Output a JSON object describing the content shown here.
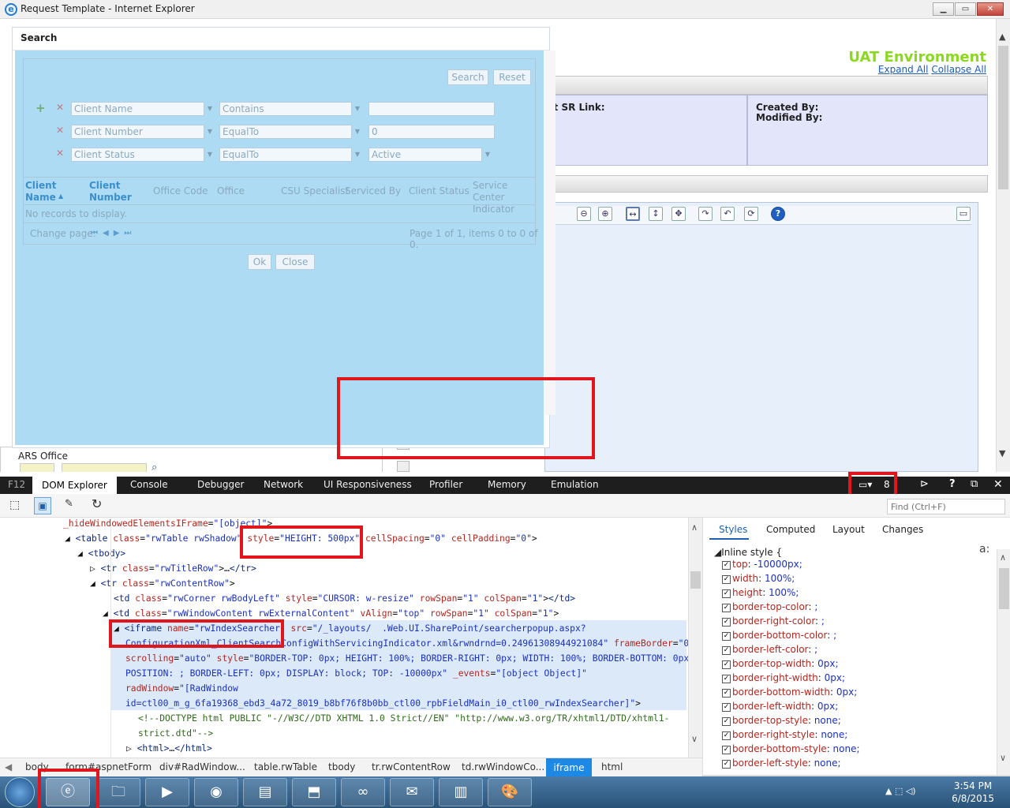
{
  "window": {
    "title": "Request Template - Internet Explorer"
  },
  "page": {
    "environment": "UAT Environment",
    "expand_all": "Expand All",
    "collapse_all": "Collapse All",
    "sr_link": "nt SR Link:",
    "created_by": "Created By:",
    "modified_by": "Modified By:",
    "ars_office": "ARS Office"
  },
  "search": {
    "header": "Search",
    "search_btn": "Search",
    "reset_btn": "Reset",
    "rows": [
      {
        "field": "Client Name",
        "op": "Contains",
        "value": ""
      },
      {
        "field": "Client Number",
        "op": "EqualTo",
        "value": "0"
      },
      {
        "field": "Client Status",
        "op": "EqualTo",
        "value": "Active"
      }
    ],
    "columns": [
      "Client Name",
      "Client Number",
      "Office Code",
      "Office",
      "CSU Specialist",
      "Serviced By",
      "Client Status",
      "Service Center Indicator"
    ],
    "no_records": "No records to display.",
    "change_page": "Change page:",
    "page_info": "Page 1 of 1, items 0 to 0 of 0.",
    "ok_btn": "Ok",
    "close_btn": "Close"
  },
  "devtools": {
    "tabs": [
      "F12",
      "DOM Explorer",
      "Console",
      "Debugger",
      "Network",
      "UI Responsiveness",
      "Profiler",
      "Memory",
      "Emulation"
    ],
    "emulation_mode": "8",
    "find_placeholder": "Find (Ctrl+F)",
    "style_tabs": [
      "Styles",
      "Computed",
      "Layout",
      "Changes"
    ],
    "inline_style": "Inline style  {",
    "styles": [
      {
        "name": "top",
        "value": "-10000px;"
      },
      {
        "name": "width",
        "value": "100%;"
      },
      {
        "name": "height",
        "value": "100%;"
      },
      {
        "name": "border-top-color",
        "value": ";"
      },
      {
        "name": "border-right-color",
        "value": ";"
      },
      {
        "name": "border-bottom-color",
        "value": ";"
      },
      {
        "name": "border-left-color",
        "value": ";"
      },
      {
        "name": "border-top-width",
        "value": "0px;"
      },
      {
        "name": "border-right-width",
        "value": "0px;"
      },
      {
        "name": "border-bottom-width",
        "value": "0px;"
      },
      {
        "name": "border-left-width",
        "value": "0px;"
      },
      {
        "name": "border-top-style",
        "value": "none;"
      },
      {
        "name": "border-right-style",
        "value": "none;"
      },
      {
        "name": "border-bottom-style",
        "value": "none;"
      },
      {
        "name": "border-left-style",
        "value": "none;"
      }
    ],
    "breadcrumbs": [
      "body",
      "form#aspnetForm",
      "div#RadWindow...",
      "table.rwTable",
      "tbody",
      "tr.rwContentRow",
      "td.rwWindowCo...",
      "iframe",
      "html"
    ]
  },
  "clock": {
    "time": "3:54 PM",
    "date": "6/8/2015"
  },
  "colors": {
    "uat_green": "#8ad91e",
    "highlight_red": "#e0161c",
    "overlay_blue": "#8ccdee"
  }
}
